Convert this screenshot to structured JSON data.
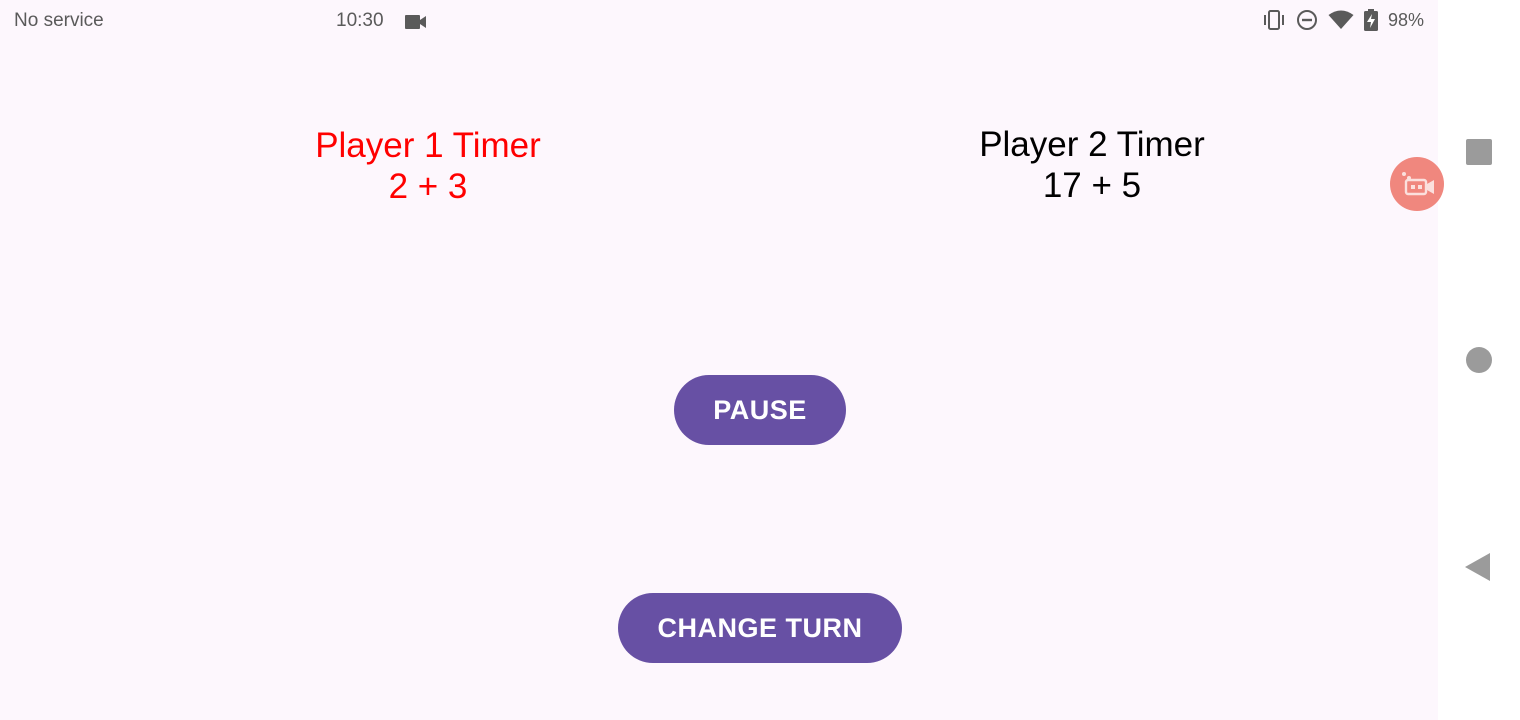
{
  "status_bar": {
    "carrier": "No service",
    "time": "10:30",
    "battery": "98%",
    "icons": [
      "video-camera-icon",
      "vibrate-icon",
      "do-not-disturb-icon",
      "wifi-icon",
      "battery-charging-icon"
    ]
  },
  "player1": {
    "title": "Player 1 Timer",
    "time": "2 + 3",
    "color": "#ff0000"
  },
  "player2": {
    "title": "Player 2 Timer",
    "time": "17 + 5",
    "color": "#000000"
  },
  "buttons": {
    "pause_label": "PAUSE",
    "change_turn_label": "CHANGE TURN",
    "color": "#6750a4"
  },
  "floating_bubble": {
    "icon": "screen-recorder-icon",
    "color": "#f0877e"
  },
  "nav_bar": {
    "items": [
      "recents-icon",
      "home-icon",
      "back-icon"
    ]
  }
}
